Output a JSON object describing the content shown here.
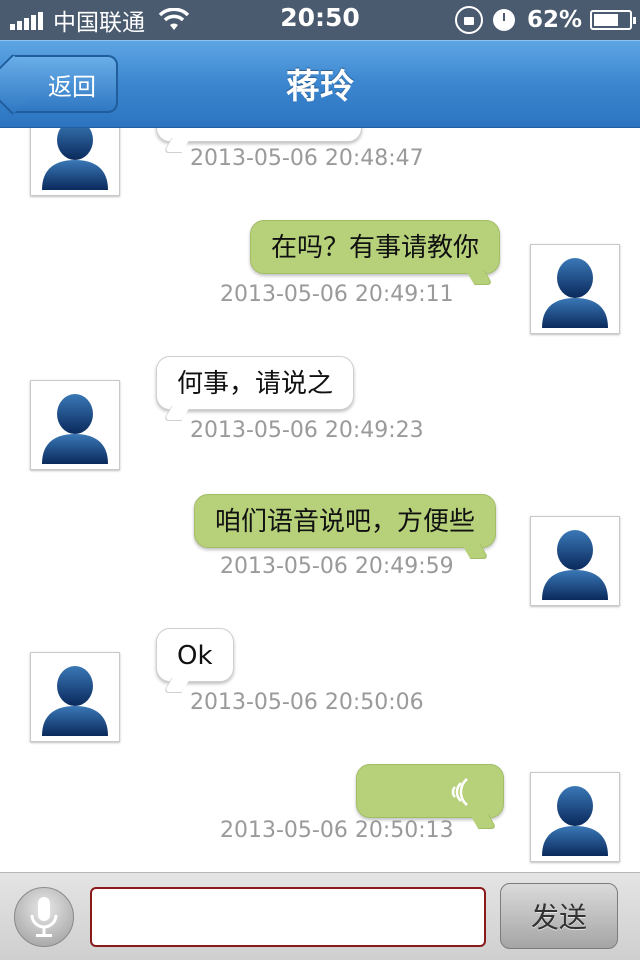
{
  "status_bar": {
    "carrier": "中国联通",
    "time": "20:50",
    "battery": "62%"
  },
  "nav": {
    "back_label": "返回",
    "title": "蒋玲"
  },
  "messages": [
    {
      "direction": "in",
      "text": "",
      "timestamp": "2013-05-06 20:48:47"
    },
    {
      "direction": "out",
      "text": "在吗？有事请教你",
      "timestamp": "2013-05-06 20:49:11"
    },
    {
      "direction": "in",
      "text": "何事，请说之",
      "timestamp": "2013-05-06 20:49:23"
    },
    {
      "direction": "out",
      "text": "咱们语音说吧，方便些",
      "timestamp": "2013-05-06 20:49:59"
    },
    {
      "direction": "in",
      "text": "Ok",
      "timestamp": "2013-05-06 20:50:06"
    },
    {
      "direction": "out",
      "type": "voice",
      "text": "",
      "timestamp": "2013-05-06 20:50:13"
    }
  ],
  "input": {
    "value": "",
    "send_label": "发送"
  },
  "colors": {
    "nav_blue": "#3b86cf",
    "outgoing_bubble": "#b6d17a",
    "incoming_bubble": "#ffffff",
    "timestamp": "#9a9a9a",
    "input_border": "#8a1a1a"
  },
  "icons": {
    "avatar": "person-silhouette-icon",
    "voice": "sound-wave-icon",
    "mic": "microphone-icon"
  }
}
